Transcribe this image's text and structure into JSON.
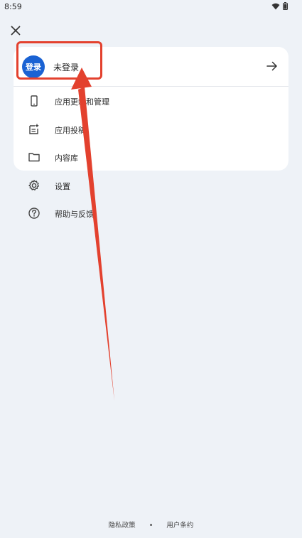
{
  "status_bar": {
    "time": "8:59"
  },
  "header": {
    "close_icon": "close-icon"
  },
  "account": {
    "avatar_text": "登录",
    "name": "未登录",
    "arrow_icon": "arrow-right-icon"
  },
  "menu": {
    "items": [
      {
        "label": "应用更新和管理",
        "icon": "phone-icon"
      },
      {
        "label": "应用投稿",
        "icon": "submit-icon"
      },
      {
        "label": "内容库",
        "icon": "folder-icon"
      }
    ]
  },
  "extra_items": [
    {
      "label": "设置",
      "icon": "gear-icon"
    },
    {
      "label": "帮助与反馈",
      "icon": "help-icon"
    }
  ],
  "footer": {
    "privacy": "隐私政策",
    "separator": "•",
    "terms": "用户条约"
  },
  "colors": {
    "background": "#eef2f7",
    "avatar": "#1a62d3",
    "annotation": "#e3412e"
  }
}
